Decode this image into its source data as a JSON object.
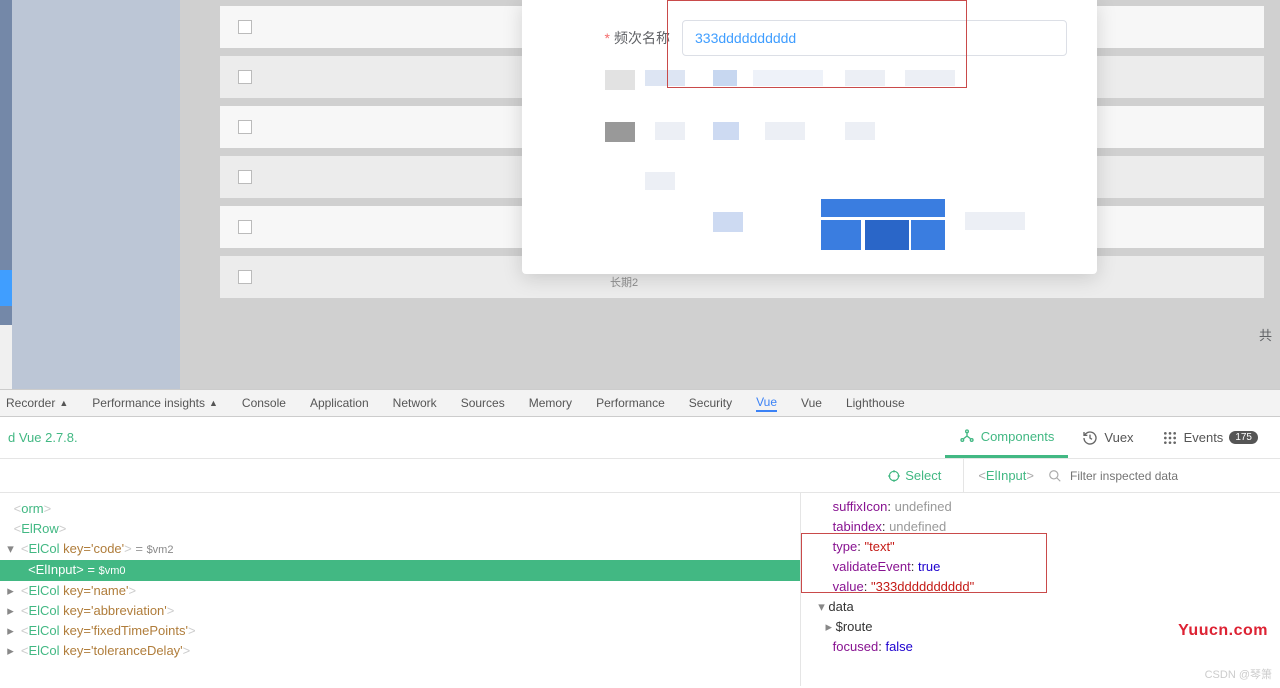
{
  "form": {
    "label": "频次名称",
    "value": "333dddddddddd",
    "footer_hint": "长期2",
    "total_label": "共"
  },
  "devtools": {
    "tabs": [
      "Recorder",
      "Performance insights",
      "Console",
      "Application",
      "Network",
      "Sources",
      "Memory",
      "Performance",
      "Security",
      "Vue",
      "Vue",
      "Lighthouse"
    ],
    "active_tab_index": 9
  },
  "vue_devtools": {
    "detected": "d Vue 2.7.8.",
    "tabs": {
      "components": "Components",
      "vuex": "Vuex",
      "events": "Events",
      "events_badge": "175"
    },
    "select_label": "Select",
    "selected_component": "ElInput",
    "filter_placeholder": "Filter inspected data"
  },
  "tree": {
    "nodes": [
      {
        "indent": 0,
        "arrow": " ",
        "tag": "orm",
        "suffix": ""
      },
      {
        "indent": 0,
        "arrow": " ",
        "tag": "ElRow",
        "suffix": ""
      },
      {
        "indent": 1,
        "arrow": "▾",
        "tag": "ElCol",
        "attr": "key='code'",
        "suffix": " = $vm2"
      },
      {
        "indent": 2,
        "arrow": " ",
        "tag": "ElInput",
        "suffix": " = $vm0",
        "selected": true
      },
      {
        "indent": 1,
        "arrow": "▸",
        "tag": "ElCol",
        "attr": "key='name'",
        "suffix": ""
      },
      {
        "indent": 1,
        "arrow": "▸",
        "tag": "ElCol",
        "attr": "key='abbreviation'",
        "suffix": ""
      },
      {
        "indent": 1,
        "arrow": "▸",
        "tag": "ElCol",
        "attr": "key='fixedTimePoints'",
        "suffix": ""
      },
      {
        "indent": 1,
        "arrow": "▸",
        "tag": "ElCol",
        "attr": "key='toleranceDelay'",
        "suffix": ""
      }
    ]
  },
  "inspect": {
    "props": [
      {
        "key": "suffixIcon",
        "type": "undef",
        "val": "undefined"
      },
      {
        "key": "tabindex",
        "type": "undef",
        "val": "undefined"
      },
      {
        "key": "type",
        "type": "str",
        "val": "\"text\""
      },
      {
        "key": "validateEvent",
        "type": "bool",
        "val": "true"
      },
      {
        "key": "value",
        "type": "str",
        "val": "\"333dddddddddd\""
      }
    ],
    "data_label": "data",
    "route_label": "$route",
    "focused": {
      "key": "focused",
      "val": "false"
    }
  },
  "watermark": "CSDN @琴箫",
  "brand": "Yuucn.com"
}
